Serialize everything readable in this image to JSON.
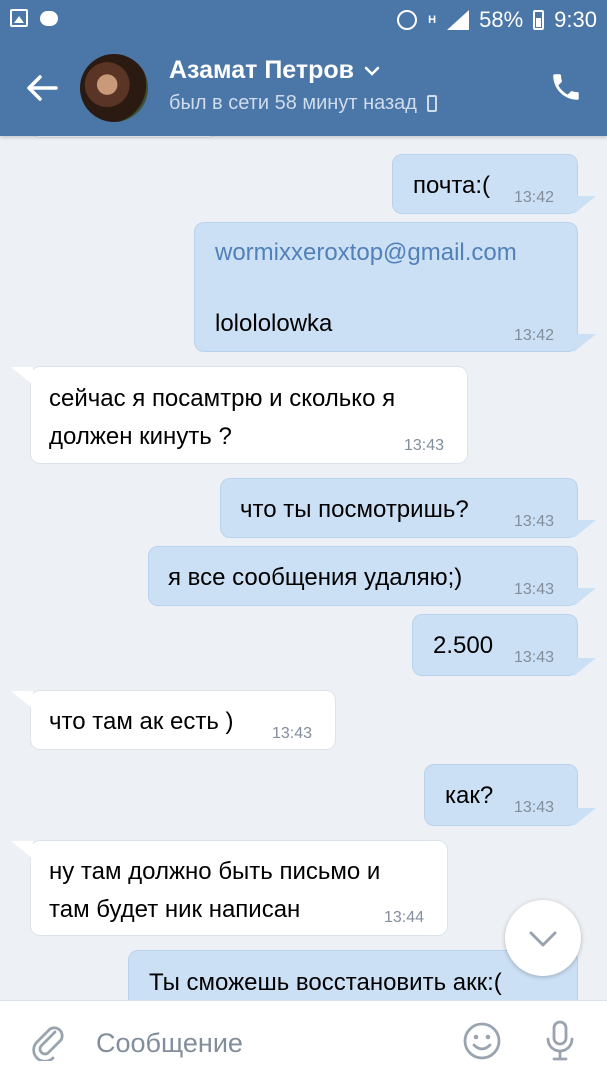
{
  "status_bar": {
    "network": "H",
    "battery": "58%",
    "time": "9:30"
  },
  "header": {
    "contact_name": "Азамат Петров",
    "last_seen": "был в сети 58 минут назад"
  },
  "messages": [
    {
      "dir": "out",
      "text": "почта:(",
      "time": "13:42"
    },
    {
      "dir": "out",
      "link": "wormixxeroxtop@gmail.com",
      "text": "lolololowka",
      "time": "13:42"
    },
    {
      "dir": "in",
      "lines": [
        "сейчас я посамтрю и сколько я",
        "должен кинуть ?"
      ],
      "time": "13:43"
    },
    {
      "dir": "out",
      "text": "что ты посмотришь?",
      "time": "13:43"
    },
    {
      "dir": "out",
      "text": "я все сообщения удаляю;)",
      "time": "13:43"
    },
    {
      "dir": "out",
      "text": "2.500",
      "time": "13:43"
    },
    {
      "dir": "in",
      "text": "что там ак есть )",
      "time": "13:43"
    },
    {
      "dir": "out",
      "text": "как?",
      "time": "13:43"
    },
    {
      "dir": "in",
      "lines": [
        "ну там должно быть письмо и",
        "там будет ник написан"
      ],
      "time": "13:44"
    },
    {
      "dir": "out",
      "text": "Ты сможешь восстановить акк:("
    }
  ],
  "composer": {
    "placeholder": "Сообщение"
  },
  "icons": [
    "image-icon",
    "chat-icon",
    "alarm-icon",
    "signal-icon",
    "battery-icon",
    "back-arrow-icon",
    "chevron-down-icon",
    "mobile-icon",
    "phone-icon",
    "scroll-down-icon",
    "paperclip-icon",
    "emoji-icon",
    "microphone-icon"
  ],
  "colors": {
    "header": "#4a76a8",
    "outgoing_bubble": "#cce0f5",
    "incoming_bubble": "#ffffff",
    "background": "#edf1f5",
    "link": "#5181b8"
  }
}
